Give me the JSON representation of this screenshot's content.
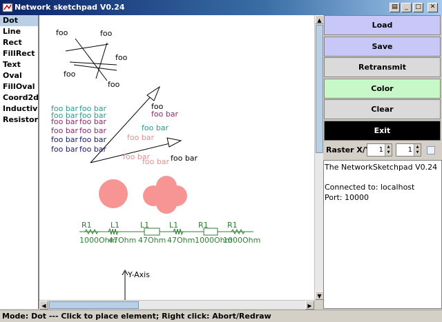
{
  "window": {
    "title": "Network sketchpad V0.24",
    "buttons": {
      "menu": "▤",
      "minimize": "_",
      "maximize": "□",
      "close": "✕"
    }
  },
  "tools": [
    {
      "label": "Dot",
      "selected": true
    },
    {
      "label": "Line"
    },
    {
      "label": "Rect"
    },
    {
      "label": "FillRect"
    },
    {
      "label": "Text"
    },
    {
      "label": "Oval"
    },
    {
      "label": "FillOval"
    },
    {
      "label": "Coord2d"
    },
    {
      "label": "Inductivity"
    },
    {
      "label": "Resistor"
    }
  ],
  "commands": {
    "load": "Load",
    "save": "Save",
    "retransmit": "Retransmit",
    "color": "Color",
    "clear": "Clear",
    "exit": "Exit"
  },
  "command_colors": {
    "load": "#c8c8f8",
    "save": "#c8c8f8",
    "retransmit": "#dadada",
    "color": "#c8f8c8",
    "clear": "#dadada",
    "exit": "#000000"
  },
  "raster": {
    "label": "Raster X/Y:",
    "x": "1",
    "y": "1"
  },
  "info_lines": [
    "The NetworkSketchpad V0.24",
    "",
    "Connected to: localhost",
    "Port: 10000"
  ],
  "status": "Mode: Dot  ---  Click to place element; Right click: Abort/Redraw",
  "canvas": {
    "foo_labels": [
      "foo",
      "foo",
      "foo",
      "foo",
      "foo"
    ],
    "arrow_labels": [
      {
        "text": "foo",
        "color": "#000000"
      },
      {
        "text": "foo bar",
        "color": "#8b2a6b"
      },
      {
        "text": "foo bar",
        "color": "#000000"
      }
    ],
    "foobar_grid": [
      {
        "left": "foo bar",
        "right": "foo bar",
        "color": "#2a9a8a"
      },
      {
        "left": "foo bar",
        "right": "foo bar",
        "color": "#2a9a8a"
      },
      {
        "left": "foo bar",
        "right": "foo bar",
        "color": "#8b2a6b"
      },
      {
        "left": "foo bar",
        "right": "foo bar",
        "color": "#8b2a6b"
      },
      {
        "left": "foo bar",
        "right": "foo bar",
        "color": "#1a1a6a"
      },
      {
        "left": "foo bar",
        "right": "foo bar",
        "color": "#1a1a6a"
      }
    ],
    "misc_labels": [
      {
        "text": "foo bar",
        "color": "#2a9a8a"
      },
      {
        "text": "foo bar",
        "color": "#e09090"
      },
      {
        "text": "foo bar",
        "color": "#e09090"
      },
      {
        "text": "foo bar",
        "color": "#e09090"
      }
    ],
    "circuit": [
      {
        "name": "R1",
        "value": "1000Ohm",
        "kind": "resistor"
      },
      {
        "name": "L1",
        "value": "47Ohm",
        "kind": "inductor"
      },
      {
        "name": "L1",
        "value": "47Ohm",
        "kind": "inductor"
      },
      {
        "name": "L1",
        "value": "47Ohm",
        "kind": "inductor"
      },
      {
        "name": "R1",
        "value": "1000Ohm",
        "kind": "resistor"
      },
      {
        "name": "R1",
        "value": "1000Ohm",
        "kind": "resistor"
      }
    ],
    "circuit_color": "#2e7d32",
    "blob_color": "#f79494",
    "axis_label": "Y-Axis"
  }
}
